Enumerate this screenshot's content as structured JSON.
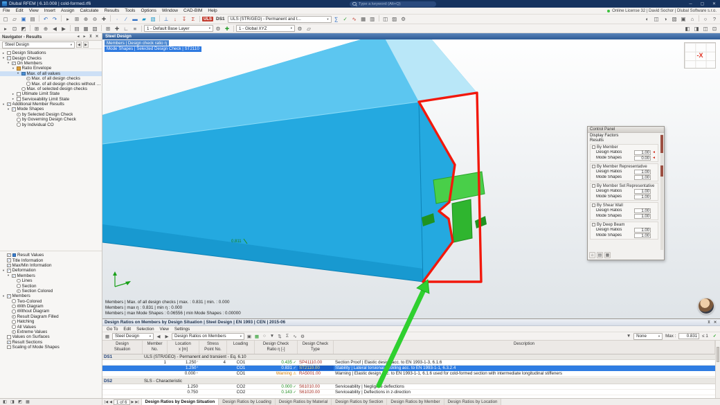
{
  "ui": {
    "caret": "▾",
    "left": "◀",
    "right": "▶"
  },
  "window": {
    "title": "Dlubal RFEM | 6.10.008 | cold-formed.rf6",
    "search_placeholder": "Type a keyword (Alt+Q)",
    "minimize_icon": "─",
    "maximize_icon": "▢",
    "close_icon": "✕"
  },
  "menubar": {
    "items": [
      "File",
      "Edit",
      "View",
      "Insert",
      "Assign",
      "Calculate",
      "Results",
      "Tools",
      "Options",
      "Window",
      "CAD-BIM",
      "Help"
    ],
    "license": "Online License 32 | David Sochor | Dlubal Software s.r.o."
  },
  "toolbar1": {
    "uls_badge": "ULS",
    "ds_badge": "DS1",
    "combo": "ULS (STR/GEO) - Permanent and t...",
    "left": [
      [
        "new-model",
        "▢"
      ],
      [
        "open-model",
        "▱"
      ],
      [
        "save-model",
        "▣",
        "blue"
      ],
      [
        "print-graphic",
        "▤"
      ],
      [
        "sep"
      ],
      [
        "undo",
        "↶",
        "blue"
      ],
      [
        "redo",
        "↷",
        "blue"
      ],
      [
        "sep"
      ],
      [
        "select-mode",
        "▸"
      ],
      [
        "zoom-window",
        "⊞"
      ],
      [
        "zoom-in",
        "⊕"
      ],
      [
        "zoom-out",
        "⊖"
      ],
      [
        "move-view",
        "✚"
      ],
      [
        "sep"
      ],
      [
        "new-node",
        "∙",
        "blue"
      ],
      [
        "new-line",
        "∕",
        "blue"
      ],
      [
        "new-member",
        "▬",
        "blue"
      ],
      [
        "new-surface",
        "▰",
        "teal"
      ],
      [
        "new-solid",
        "▧",
        "teal"
      ],
      [
        "sep"
      ],
      [
        "nodal-support",
        "⊥",
        "blue"
      ],
      [
        "nodal-load",
        "↓",
        "red"
      ],
      [
        "member-load",
        "↧",
        "red"
      ],
      [
        "load-case",
        "Σ",
        "red"
      ]
    ],
    "mid": [
      [
        "calculate-all",
        "∑",
        "blue"
      ],
      [
        "design-check",
        "✓",
        "green"
      ],
      [
        "show-results",
        "∿",
        "red"
      ],
      [
        "result-tables",
        "▦"
      ],
      [
        "printout-report",
        "▥"
      ],
      [
        "sep"
      ],
      [
        "sections",
        "◫"
      ],
      [
        "materials",
        "▨"
      ],
      [
        "units-settings",
        "⚙"
      ]
    ],
    "right": [
      [
        "visibility",
        "◐"
      ],
      [
        "clipping-planes",
        "◫"
      ],
      [
        "rendering",
        "◑"
      ],
      [
        "display-properties",
        "▧"
      ],
      [
        "user-view",
        "▣"
      ],
      [
        "views",
        "⌂"
      ],
      [
        "sep"
      ],
      [
        "find-object",
        "○"
      ],
      [
        "help",
        "?"
      ]
    ]
  },
  "toolbar2": {
    "layer_combo": "1 - Default Base Layer",
    "axes_combo": "1 - Global XYZ",
    "a": [
      [
        "edit-mode",
        "▸"
      ],
      [
        "select-all",
        "⊡"
      ],
      [
        "invert-selection",
        "◩"
      ],
      [
        "sep"
      ],
      [
        "show-all",
        "⊞"
      ],
      [
        "zoom-to-selection",
        "⊕"
      ],
      [
        "previous-zoom",
        "◀"
      ],
      [
        "next-zoom",
        "▶"
      ],
      [
        "sep"
      ],
      [
        "wireframe",
        "▤"
      ],
      [
        "solid-display",
        "▦"
      ],
      [
        "transparent-display",
        "▧"
      ],
      [
        "sep"
      ],
      [
        "grid-toggle",
        "⊞"
      ],
      [
        "snap-toggle",
        "✚"
      ],
      [
        "ortho-toggle",
        "∟"
      ],
      [
        "guidelines",
        "≡"
      ]
    ],
    "b": [
      [
        "layer-settings",
        "⚙"
      ],
      [
        "new-layer",
        "✚",
        "green"
      ]
    ],
    "c": [
      [
        "axes-settings",
        "⚙"
      ],
      [
        "work-plane",
        "▱"
      ]
    ],
    "right": [
      [
        "renderer-settings",
        "◧"
      ],
      [
        "background",
        "◨"
      ],
      [
        "split-view",
        "◫"
      ],
      [
        "full-view",
        "⊡"
      ]
    ]
  },
  "navigator": {
    "title": "Navigator - Results",
    "combo": "Steel Design",
    "header_icons": [
      [
        "nav-back",
        "◂"
      ],
      [
        "nav-forward",
        "▸"
      ],
      [
        "pin-panel",
        "⊼"
      ],
      [
        "close-panel",
        "✕"
      ]
    ],
    "results_tree": [
      {
        "d": 0,
        "e": 0,
        "t": "cb",
        "c": false,
        "label": "Design Situations"
      },
      {
        "d": 0,
        "e": 1,
        "t": "cb",
        "c": true,
        "label": "Design Checks"
      },
      {
        "d": 1,
        "e": 1,
        "t": "cb",
        "c": true,
        "label": "On Members"
      },
      {
        "d": 2,
        "e": 1,
        "t": "ic",
        "ic": "#e0a13a",
        "label": "Ratio Envelope"
      },
      {
        "d": 3,
        "e": 1,
        "t": "ic",
        "ic": "#4b8fd4",
        "label": "Max. of all values",
        "hl": true
      },
      {
        "d": 4,
        "t": "radio",
        "sel": true,
        "label": "Max. of all design checks"
      },
      {
        "d": 4,
        "t": "radio",
        "sel": false,
        "label": "Max. of all design checks without e..."
      },
      {
        "d": 3,
        "t": "radio",
        "sel": false,
        "label": "Max. of selected design checks"
      },
      {
        "d": 2,
        "e": 0,
        "t": "cb",
        "c": false,
        "label": "Ultimate Limit State"
      },
      {
        "d": 2,
        "e": 0,
        "t": "cb",
        "c": false,
        "label": "Serviceability Limit State"
      },
      {
        "d": 0,
        "e": 1,
        "t": "cb",
        "c": true,
        "label": "Additional Member Results"
      },
      {
        "d": 1,
        "e": 1,
        "t": "cb",
        "c": true,
        "label": "Mode Shapes"
      },
      {
        "d": 2,
        "t": "radio",
        "sel": true,
        "label": "by Selected Design Check"
      },
      {
        "d": 2,
        "t": "radio",
        "sel": false,
        "label": "by Governing Design Check"
      },
      {
        "d": 2,
        "t": "radio",
        "sel": false,
        "label": "by Individual CO"
      }
    ],
    "display_tree": [
      {
        "d": 0,
        "t": "cb",
        "c": true,
        "ic": "#3b7fd0",
        "label": "Result Values"
      },
      {
        "d": 0,
        "t": "cb",
        "c": true,
        "label": "Title Information"
      },
      {
        "d": 0,
        "t": "cb",
        "c": true,
        "label": "Max/Min Information"
      },
      {
        "d": 0,
        "e": 1,
        "t": "cb",
        "c": true,
        "label": "Deformation"
      },
      {
        "d": 1,
        "e": 1,
        "t": "cb",
        "c": true,
        "label": "Members"
      },
      {
        "d": 2,
        "t": "radio",
        "sel": false,
        "label": "Lines"
      },
      {
        "d": 2,
        "t": "radio",
        "sel": false,
        "label": "Section"
      },
      {
        "d": 2,
        "t": "radio",
        "sel": true,
        "label": "Section Colored"
      },
      {
        "d": 0,
        "e": 1,
        "t": "cb",
        "c": true,
        "label": "Members"
      },
      {
        "d": 1,
        "t": "radio",
        "sel": false,
        "label": "Two-Colored"
      },
      {
        "d": 1,
        "t": "radio",
        "sel": false,
        "label": "With Diagram"
      },
      {
        "d": 1,
        "t": "radio",
        "sel": false,
        "label": "Without Diagram"
      },
      {
        "d": 1,
        "t": "radio",
        "sel": true,
        "label": "Result Diagram Filled"
      },
      {
        "d": 1,
        "t": "radio",
        "sel": false,
        "label": "Hatching"
      },
      {
        "d": 1,
        "t": "radio",
        "sel": false,
        "label": "All Values"
      },
      {
        "d": 1,
        "t": "radio",
        "sel": true,
        "label": "Extreme Values"
      },
      {
        "d": 0,
        "t": "cb",
        "c": false,
        "label": "Values on Surfaces"
      },
      {
        "d": 0,
        "t": "cb",
        "c": true,
        "label": "Result Sections"
      },
      {
        "d": 0,
        "t": "cb",
        "c": false,
        "label": "Scaling of Mode Shapes"
      }
    ]
  },
  "viewport": {
    "header": "Steel Design",
    "line1": "Members | Design check ratio η",
    "line2": "Mode Shapes | Selected Design Check | ST2110",
    "value_label": "0.811",
    "status1": "Members | Max. of all design checks | max. : 0.831 | min. : 0.000",
    "status2": "Members | max η : 0.831 | min η : 0.000",
    "status3": "Members | max Mode Shapes : 0.06556 | min Mode Shapes : 0.00000",
    "cube_label": "-X"
  },
  "control_panel": {
    "title": "Control Panel",
    "sub1": "Display Factors",
    "sub2": "Results",
    "foot_icons": [
      [
        "panel-home",
        "⌂"
      ],
      [
        "panel-list",
        "▤"
      ],
      [
        "panel-grid",
        "▦"
      ]
    ],
    "groups": [
      {
        "label": "By Member",
        "rows": [
          {
            "label": "Design Ratios",
            "value": "1.00",
            "marker": true
          },
          {
            "label": "Mode Shapes",
            "value": "0.00",
            "marker": true
          }
        ]
      },
      {
        "label": "By Member Representative",
        "rows": [
          {
            "label": "Design Ratios",
            "value": "1.00"
          },
          {
            "label": "Mode Shapes",
            "value": "1.00"
          }
        ]
      },
      {
        "label": "By Member Set Representative",
        "rows": [
          {
            "label": "Design Ratios",
            "value": "1.00"
          },
          {
            "label": "Mode Shapes",
            "value": "1.00"
          }
        ]
      },
      {
        "label": "By Shear Wall",
        "rows": [
          {
            "label": "Design Ratios",
            "value": "1.00"
          },
          {
            "label": "Mode Shapes",
            "value": "1.00"
          }
        ]
      },
      {
        "label": "By Deep Beam",
        "rows": [
          {
            "label": "Design Ratios",
            "value": "1.00"
          },
          {
            "label": "Mode Shapes",
            "value": "1.00"
          }
        ]
      }
    ]
  },
  "table": {
    "title": "Design Ratios on Members by Design Situation | Steel Design | EN 1993 | CEN | 2015-06",
    "title_icons": [
      [
        "pin-panel",
        "⊼"
      ],
      [
        "close-panel",
        "✕"
      ]
    ],
    "menus": [
      "Go To",
      "Edit",
      "Selection",
      "View",
      "Settings"
    ],
    "toolbar": {
      "module": "Steel Design",
      "view": "Design Ratios on Members",
      "filter": "None",
      "max_label": "Max :",
      "max_value": "0.831",
      "limit_label": "≤ 1",
      "icons": [
        [
          "copy-table",
          "▣"
        ],
        [
          "export-excel",
          "▦",
          "green"
        ],
        [
          "search-table",
          "○"
        ],
        [
          "filter-rows",
          "▼"
        ],
        [
          "sort-rows",
          "⇅"
        ],
        [
          "sum-row",
          "Σ"
        ],
        [
          "result-diagram",
          "∿"
        ],
        [
          "table-settings",
          "⚙"
        ]
      ]
    },
    "columns": [
      [
        "Design",
        "Situation"
      ],
      [
        "Member",
        "No."
      ],
      [
        "Location",
        "x [m]"
      ],
      [
        "Stress",
        "Point No."
      ],
      [
        "Loading",
        ""
      ],
      [
        "Design Check",
        "Ratio η [-]"
      ],
      [
        "Design Check",
        "Type"
      ],
      [
        "Description",
        ""
      ]
    ],
    "rows": [
      {
        "kind": "group",
        "ds": "DS1",
        "desc": "ULS (STR/GEO) - Permanent and transient - Eq. 6.10"
      },
      {
        "kind": "data",
        "member": "1",
        "loc": "1.250",
        "locmark": "¹",
        "sp": "4",
        "load": "CO1",
        "ratio": "0.435",
        "rmark": "✓",
        "code": "SP41110.00",
        "desc": "Section Proof | Elastic design acc. to EN 1993-1-3, 6.1.6"
      },
      {
        "kind": "data",
        "sel": true,
        "loc": "1.250",
        "locmark": "¹",
        "load": "CO1",
        "ratio": "0.831",
        "rmark": "✓",
        "code": "ST2110.00",
        "desc": "Stability | Lateral torsional buckling acc. to EN 1993-1-1, 6.3.2.4"
      },
      {
        "kind": "data",
        "loc": "0.000",
        "locmark": "×",
        "load": "CO1",
        "ratio": "Warning",
        "rmark": "⚠",
        "warn": true,
        "code": "RA5001.00",
        "desc": "Warning | Elastic design acc. to EN 1993-1-1, 6.1.6 used for cold-formed section with intermediate longitudinal stiffeners"
      },
      {
        "kind": "spacer"
      },
      {
        "kind": "group",
        "ds": "DS2",
        "desc": "SLS - Characteristic"
      },
      {
        "kind": "data",
        "loc": "1.250",
        "load": "CO2",
        "ratio": "0.000",
        "r mark_unused": "",
        "rmark": "✓",
        "code": "S61010.00",
        "desc": "Serviceability | Negligible deflections"
      },
      {
        "kind": "data",
        "loc": "0.750",
        "load": "CO2",
        "ratio": "0.143",
        "rmark": "✓",
        "code": "S61020.00",
        "desc": "Serviceability | Deflections in z-direction"
      }
    ],
    "active_tab": 0,
    "tabs": [
      "Design Ratios by Design Situation",
      "Design Ratios by Loading",
      "Design Ratios by Material",
      "Design Ratios by Section",
      "Design Ratios by Member",
      "Design Ratios by Location"
    ]
  },
  "bottombar": {
    "icons": [
      [
        "dock-layout-1",
        "◧"
      ],
      [
        "dock-layout-2",
        "◨"
      ],
      [
        "dock-layout-3",
        "◩"
      ],
      [
        "dock-layout-4",
        "▦"
      ]
    ],
    "first": "|◀",
    "prev": "◀",
    "page": "1 of 6",
    "next": "▶",
    "last": "▶|"
  }
}
